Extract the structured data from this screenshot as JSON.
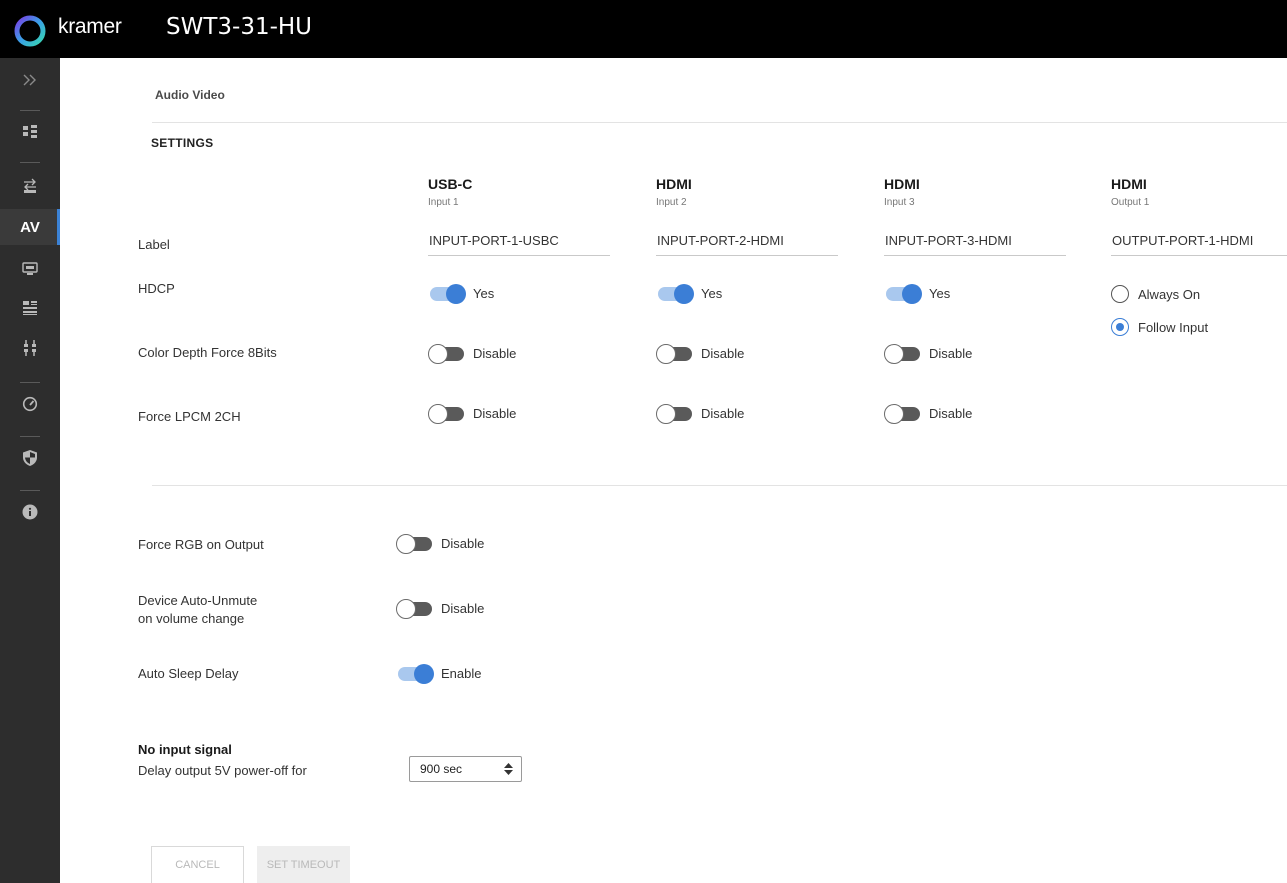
{
  "header": {
    "brand": "kramer",
    "device_name": "SWT3-31-HU"
  },
  "sidebar": {
    "items": [
      {
        "icon": "double-chevron-right-icon"
      },
      {
        "icon": "routing-icon"
      },
      {
        "icon": "auto-switch-icon"
      },
      {
        "icon": "av-text-icon",
        "label": "AV",
        "active": true
      },
      {
        "icon": "edid-icon"
      },
      {
        "icon": "device-settings-icon"
      },
      {
        "icon": "connectors-icon"
      },
      {
        "icon": "gauge-icon"
      },
      {
        "icon": "security-shield-icon"
      },
      {
        "icon": "info-icon"
      }
    ]
  },
  "breadcrumb": "Audio Video",
  "section_title": "SETTINGS",
  "columns": [
    {
      "name": "USB-C",
      "sub": "Input 1",
      "label_value": "INPUT-PORT-1-USBC"
    },
    {
      "name": "HDMI",
      "sub": "Input 2",
      "label_value": "INPUT-PORT-2-HDMI"
    },
    {
      "name": "HDMI",
      "sub": "Input 3",
      "label_value": "INPUT-PORT-3-HDMI"
    },
    {
      "name": "HDMI",
      "sub": "Output 1",
      "label_value": "OUTPUT-PORT-1-HDMI"
    }
  ],
  "rows": {
    "label": "Label",
    "hdcp": "HDCP",
    "color_depth": "Color Depth Force 8Bits",
    "force_lpcm": "Force LPCM 2CH"
  },
  "toggles": {
    "yes": "Yes",
    "disable": "Disable",
    "enable": "Enable"
  },
  "hdcp_output": {
    "options": [
      "Always On",
      "Follow Input"
    ],
    "selected": "Follow Input"
  },
  "general": {
    "force_rgb_label": "Force RGB on Output",
    "auto_unmute_label_1": "Device Auto-Unmute",
    "auto_unmute_label_2": "on volume change",
    "auto_sleep_label": "Auto Sleep Delay"
  },
  "no_input": {
    "title": "No input signal",
    "delay_label": "Delay output 5V power-off for",
    "delay_value": "900 sec"
  },
  "buttons": {
    "cancel": "CANCEL",
    "set_timeout": "SET TIMEOUT"
  },
  "colors": {
    "accent": "#3b7ed6",
    "topbar": "#000000",
    "sidebar": "#2d2d2d"
  }
}
